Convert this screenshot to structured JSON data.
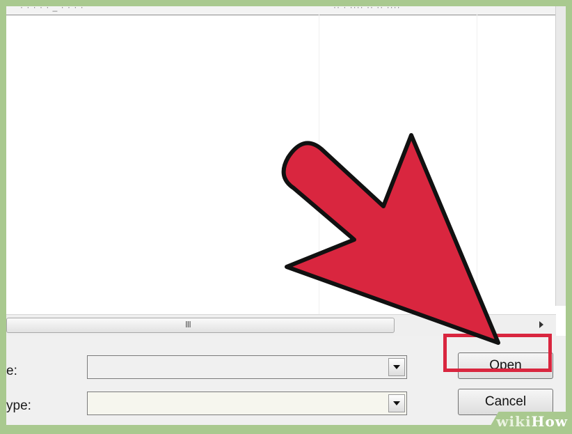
{
  "dialog": {
    "header": {
      "left_text": "· · · · · _ · · · ·",
      "right_text": "·· · ···· ·· ·· ····"
    },
    "hscroll": {
      "grip": "III"
    },
    "file_name": {
      "label": "e:",
      "value": "",
      "placeholder": ""
    },
    "file_type": {
      "label": "ype:",
      "value": ""
    },
    "buttons": {
      "open": "Open",
      "cancel": "Cancel"
    }
  },
  "annotation": {
    "arrow_color": "#d9263f",
    "highlight_color": "#d9263f"
  },
  "watermark": {
    "wiki": "wiki",
    "how": "How"
  },
  "colors": {
    "background": "#a9c98f",
    "panel": "#f0f0f0"
  }
}
